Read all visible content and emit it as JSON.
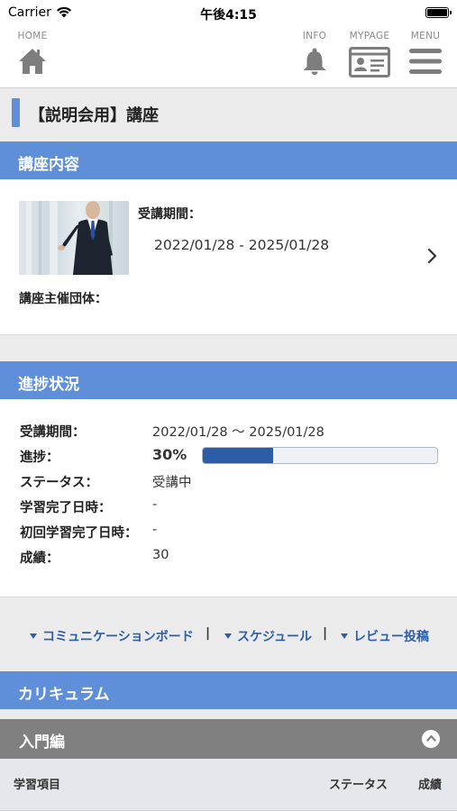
{
  "status_bar": {
    "carrier": "Carrier",
    "time": "午後4:15"
  },
  "nav": {
    "home": "HOME",
    "info": "INFO",
    "mypage": "MYPAGE",
    "menu": "MENU"
  },
  "page_title": "【説明会用】講座",
  "course_section": {
    "header": "講座内容",
    "period_label": "受講期間：",
    "period_value": "2022/01/28 - 2025/01/28",
    "organizer_label": "講座主催団体："
  },
  "progress_section": {
    "header": "進捗状況",
    "rows": [
      {
        "label": "受講期間：",
        "value": "2022/01/28 ～ 2025/01/28"
      },
      {
        "label": "進捗：",
        "value": "30%"
      },
      {
        "label": "ステータス：",
        "value": "受講中"
      },
      {
        "label": "学習完了日時：",
        "value": "-"
      },
      {
        "label": "初回学習完了日時：",
        "value": "-"
      },
      {
        "label": "成績：",
        "value": "30"
      }
    ],
    "progress_fraction": 0.3
  },
  "links": [
    {
      "label": "コミュニケーションボード"
    },
    {
      "label": "スケジュール"
    },
    {
      "label": "レビュー投稿"
    }
  ],
  "link_separator": "|",
  "curriculum": {
    "header": "カリキュラム",
    "chapter": "入門編",
    "columns": [
      "学習項目",
      "ステータス",
      "成績"
    ]
  },
  "colors": {
    "accent_blue": "#5f8fd9",
    "link_blue": "#2c5ea8",
    "chapter_gray": "#808080"
  }
}
